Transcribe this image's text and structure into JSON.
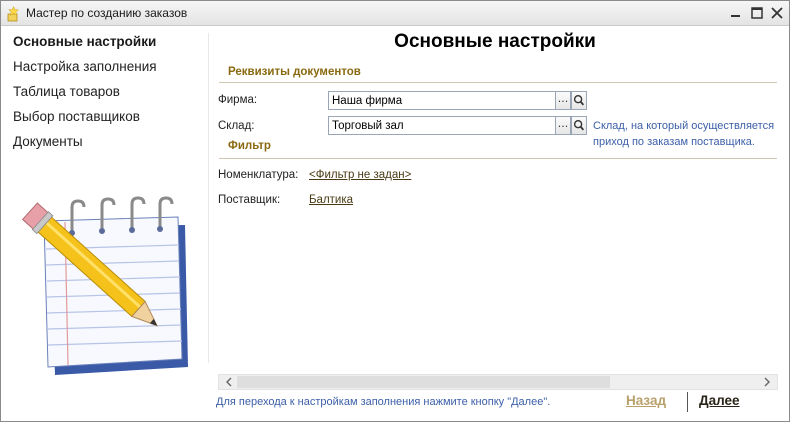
{
  "window": {
    "title": "Мастер по созданию заказов",
    "icons": [
      "wizard-icon",
      "minimize-icon",
      "maximize-icon",
      "close-icon"
    ]
  },
  "sidebar": {
    "items": [
      {
        "label": "Основные настройки",
        "active": true
      },
      {
        "label": "Настройка заполнения",
        "active": false
      },
      {
        "label": "Таблица товаров",
        "active": false
      },
      {
        "label": "Выбор поставщиков",
        "active": false
      },
      {
        "label": "Документы",
        "active": false
      }
    ]
  },
  "main": {
    "title": "Основные настройки",
    "requisites": {
      "group_title": "Реквизиты документов",
      "firm": {
        "label": "Фирма:",
        "value": "Наша фирма"
      },
      "warehouse": {
        "label": "Склад:",
        "value": "Торговый зал",
        "hint": "Склад, на который осуществляется приход по заказам поставщика."
      }
    },
    "filter": {
      "group_title": "Фильтр",
      "nomenclature": {
        "label": "Номенклатура:",
        "value": "<Фильтр не задан>"
      },
      "supplier": {
        "label": "Поставщик:",
        "value": "Балтика"
      }
    },
    "select_button": "...",
    "search_icon": "magnifier-icon"
  },
  "footer": {
    "hint": "Для перехода к настройкам заполнения нажмите кнопку \"Далее\".",
    "back_label": "Назад",
    "next_label": "Далее"
  },
  "colors": {
    "group_title": "#8a6a10",
    "hint": "#3c5fa8",
    "back_disabled": "#b8a06a",
    "next": "#2a2418"
  }
}
